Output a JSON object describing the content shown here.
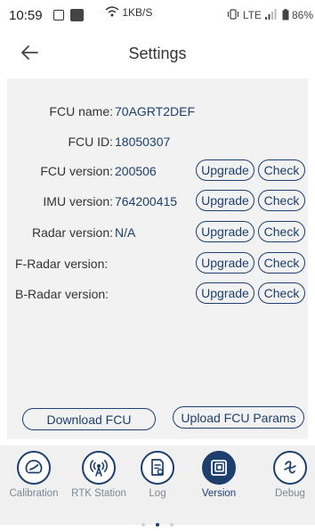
{
  "status_bar": {
    "time": "10:59",
    "network_speed": "1KB/S",
    "right_indicators": "LTE",
    "battery": "86%"
  },
  "header": {
    "title": "Settings"
  },
  "info": {
    "fcu_name_label": "FCU name:",
    "fcu_name_value": "70AGRT2DEF",
    "fcu_id_label": "FCU ID:",
    "fcu_id_value": "18050307"
  },
  "versions": [
    {
      "label": "FCU version:",
      "value": "200506",
      "upgrade": "Upgrade",
      "check": "Check"
    },
    {
      "label": "IMU version:",
      "value": "764200415",
      "upgrade": "Upgrade",
      "check": "Check"
    },
    {
      "label": "Radar version:",
      "value": "N/A",
      "upgrade": "Upgrade",
      "check": "Check"
    },
    {
      "label": "F-Radar version:",
      "value": "",
      "upgrade": "Upgrade",
      "check": "Check"
    },
    {
      "label": "B-Radar version:",
      "value": "",
      "upgrade": "Upgrade",
      "check": "Check"
    }
  ],
  "actions": {
    "download_fcu": "Download FCU",
    "upload_fcu_params": "Upload FCU Params"
  },
  "tabs": [
    {
      "label": "Calibration",
      "icon": "calibration-icon"
    },
    {
      "label": "RTK Station",
      "icon": "rtk-station-icon"
    },
    {
      "label": "Log",
      "icon": "log-icon"
    },
    {
      "label": "Version",
      "icon": "version-icon",
      "active": true
    },
    {
      "label": "Debug",
      "icon": "debug-icon"
    }
  ],
  "page_indicator": {
    "pages": 3,
    "current": 2
  },
  "colors": {
    "accent": "#1c3f6e",
    "panel_bg": "#f2f2f2",
    "tabbar_bg": "#f0f0f0"
  }
}
